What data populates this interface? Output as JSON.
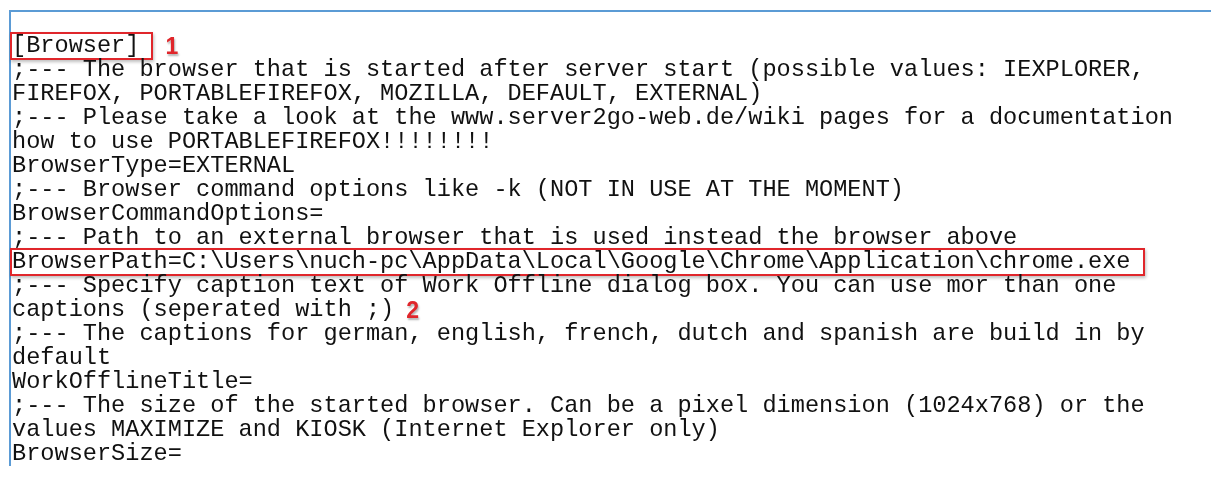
{
  "editor": {
    "lines": [
      {
        "text": "[Browser]",
        "highlighted": true,
        "marker": "1"
      },
      {
        "text": ";--- The browser that is started after server start (possible values: IEXPLORER,",
        "highlighted": false
      },
      {
        "text": "FIREFOX, PORTABLEFIREFOX, MOZILLA, DEFAULT, EXTERNAL)",
        "highlighted": false
      },
      {
        "text": ";--- Please take a look at the www.server2go-web.de/wiki pages for a documentation",
        "highlighted": false
      },
      {
        "text": "how to use PORTABLEFIREFOX!!!!!!!!",
        "highlighted": false
      },
      {
        "text": "BrowserType=EXTERNAL",
        "highlighted": false
      },
      {
        "text": ";--- Browser command options like -k (NOT IN USE AT THE MOMENT)",
        "highlighted": false
      },
      {
        "text": "BrowserCommandOptions=",
        "highlighted": false
      },
      {
        "text": ";--- Path to an external browser that is used instead the browser above",
        "highlighted": false
      },
      {
        "text": "BrowserPath=C:\\Users\\nuch-pc\\AppData\\Local\\Google\\Chrome\\Application\\chrome.exe",
        "highlighted": true
      },
      {
        "text": ";--- Specify caption text of Work Offline dialog box. You can use mor than one",
        "highlighted": false
      },
      {
        "text": "captions (seperated with ;)",
        "highlighted": false,
        "marker": "2"
      },
      {
        "text": ";--- The captions for german, english, french, dutch and spanish are build in by",
        "highlighted": false
      },
      {
        "text": "default",
        "highlighted": false
      },
      {
        "text": "WorkOfflineTitle=",
        "highlighted": false
      },
      {
        "text": ";--- The size of the started browser. Can be a pixel dimension (1024x768) or the",
        "highlighted": false
      },
      {
        "text": "values MAXIMIZE and KIOSK (Internet Explorer only)",
        "highlighted": false
      },
      {
        "text": "BrowserSize=",
        "highlighted": false
      }
    ]
  }
}
